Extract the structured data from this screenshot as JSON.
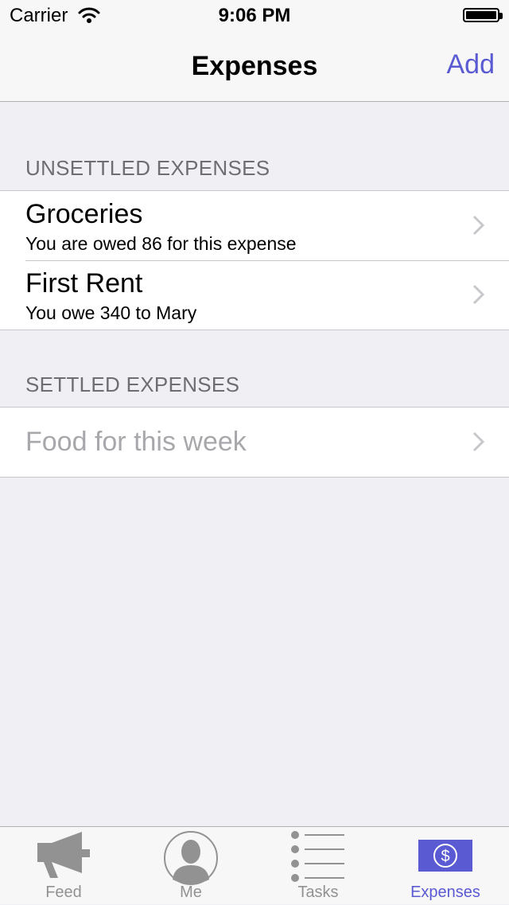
{
  "status": {
    "carrier": "Carrier",
    "time": "9:06 PM"
  },
  "nav": {
    "title": "Expenses",
    "add_label": "Add"
  },
  "sections": {
    "unsettled": {
      "header": "UNSETTLED EXPENSES",
      "items": [
        {
          "title": "Groceries",
          "subtitle": "You are owed 86 for this expense"
        },
        {
          "title": "First Rent",
          "subtitle": "You owe 340 to Mary"
        }
      ]
    },
    "settled": {
      "header": "SETTLED EXPENSES",
      "items": [
        {
          "title": "Food for this week"
        }
      ]
    }
  },
  "tabs": [
    {
      "label": "Feed",
      "icon": "megaphone-icon"
    },
    {
      "label": "Me",
      "icon": "person-icon"
    },
    {
      "label": "Tasks",
      "icon": "list-icon"
    },
    {
      "label": "Expenses",
      "icon": "dollar-icon",
      "active": true
    }
  ],
  "colors": {
    "accent": "#5a5ad2",
    "background": "#efeff4",
    "inactive_tab": "#929292"
  }
}
